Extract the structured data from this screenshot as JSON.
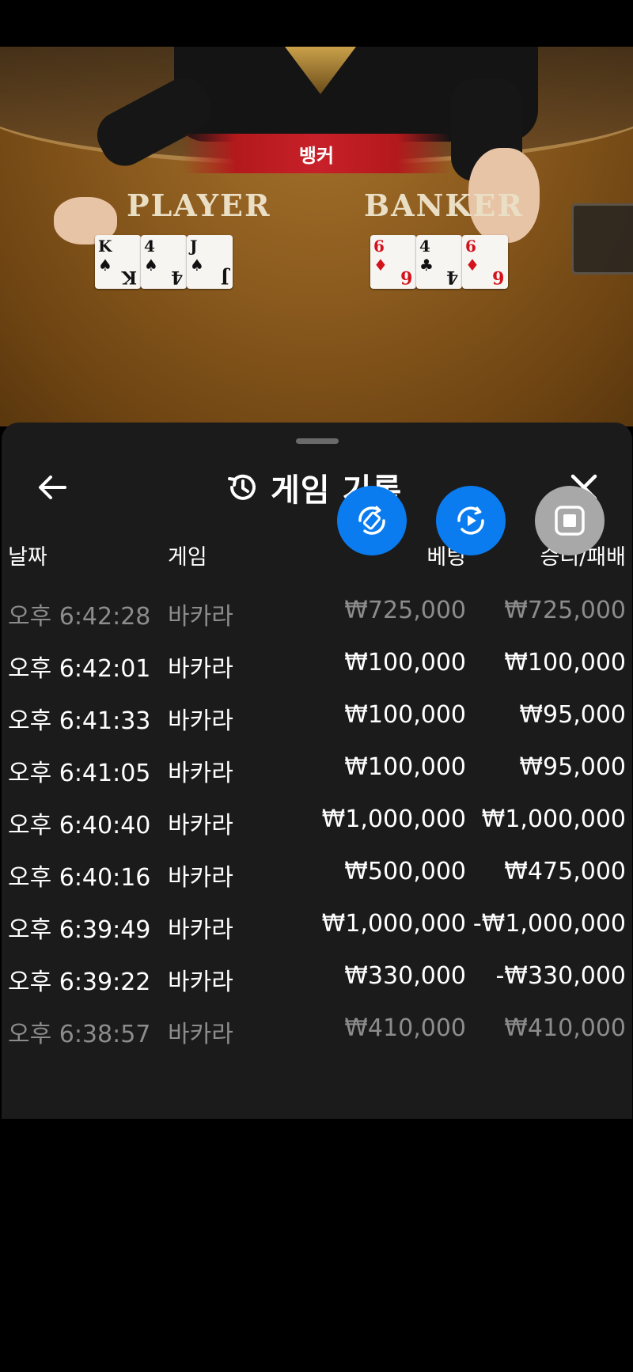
{
  "video": {
    "banner_label": "뱅커",
    "player_label": "PLAYER",
    "banker_label": "BANKER",
    "player_cards": [
      {
        "rank": "K",
        "suit": "♠",
        "red": false
      },
      {
        "rank": "4",
        "suit": "♠",
        "red": false
      },
      {
        "rank": "J",
        "suit": "♠",
        "red": false
      }
    ],
    "banker_cards": [
      {
        "rank": "6",
        "suit": "♦",
        "red": true
      },
      {
        "rank": "4",
        "suit": "♣",
        "red": false
      },
      {
        "rank": "6",
        "suit": "♦",
        "red": true
      }
    ]
  },
  "sheet": {
    "title": "게임 기록",
    "title_icon": "history-icon",
    "back_icon": "arrow-left-icon",
    "close_icon": "close-icon"
  },
  "table": {
    "headers": {
      "date": "날짜",
      "game": "게임",
      "bet": "베팅",
      "win": "승리/패배"
    },
    "rows": [
      {
        "date": "오후 6:42:28",
        "game": "바카라",
        "bet": "₩725,000",
        "win": "₩725,000",
        "style": "dim"
      },
      {
        "date": "오후 6:42:01",
        "game": "바카라",
        "bet": "₩100,000",
        "win": "₩100,000",
        "style": "normal"
      },
      {
        "date": "오후 6:41:33",
        "game": "바카라",
        "bet": "₩100,000",
        "win": "₩95,000",
        "style": "normal"
      },
      {
        "date": "오후 6:41:05",
        "game": "바카라",
        "bet": "₩100,000",
        "win": "₩95,000",
        "style": "normal"
      },
      {
        "date": "오후 6:40:40",
        "game": "바카라",
        "bet": "₩1,000,000",
        "win": "₩1,000,000",
        "style": "normal"
      },
      {
        "date": "오후 6:40:16",
        "game": "바카라",
        "bet": "₩500,000",
        "win": "₩475,000",
        "style": "normal"
      },
      {
        "date": "오후 6:39:49",
        "game": "바카라",
        "bet": "₩1,000,000",
        "win": "-₩1,000,000",
        "style": "normal"
      },
      {
        "date": "오후 6:39:22",
        "game": "바카라",
        "bet": "₩330,000",
        "win": "-₩330,000",
        "style": "normal"
      },
      {
        "date": "오후 6:38:57",
        "game": "바카라",
        "bet": "₩410,000",
        "win": "₩410,000",
        "style": "dim"
      }
    ]
  },
  "floating_buttons": [
    {
      "icon": "rotate-screen-icon",
      "color": "#0a7cf0"
    },
    {
      "icon": "replay-icon",
      "color": "#0a7cf0"
    },
    {
      "icon": "stop-record-icon",
      "color": "#a8a8a8"
    }
  ]
}
